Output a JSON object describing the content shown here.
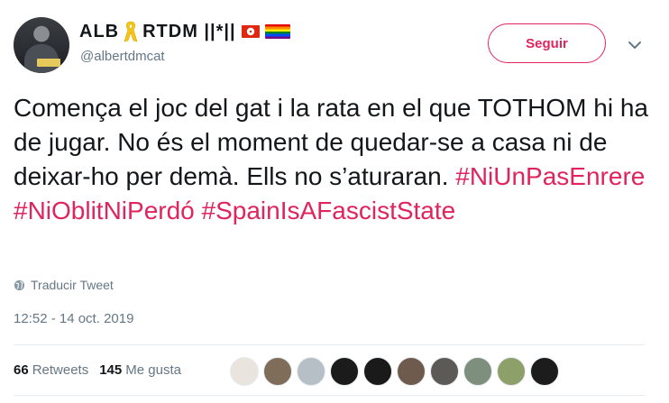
{
  "author": {
    "display_name_left": "ALB",
    "display_name_right": "RTDM ||*||",
    "handle": "@albertdmcat"
  },
  "follow_button": {
    "label": "Seguir"
  },
  "tweet": {
    "text_plain": "Comença el joc del gat i la rata en el que TOTHOM hi ha de jugar. No és el moment de quedar-se a casa ni de deixar-ho per demà. Ells no s’aturaran.",
    "hashtags": [
      "#NiUnPasEnrere",
      "#NiOblitNiPerdó",
      "#SpainIsAFascistState"
    ],
    "translate_label": "Traducir Tweet",
    "timestamp": "12:52 - 14 oct. 2019"
  },
  "stats": {
    "retweets_count": "66",
    "retweets_label": "Retweets",
    "likes_count": "145",
    "likes_label": "Me gusta"
  },
  "colors": {
    "accent": "#e0245e",
    "secondary_text": "#657786",
    "divider": "#e6ecf0"
  },
  "icons": {
    "ribbon": "yellow-ribbon-icon",
    "chevron": "chevron-down-icon",
    "globe": "globe-icon"
  },
  "liker_avatar_colors": [
    "#e9e4de",
    "#7f6d5a",
    "#b7bfc6",
    "#1b1b1b",
    "#1a1a1a",
    "#6f5b4e",
    "#5c5a57",
    "#7f8f7d",
    "#8ea06a",
    "#1c1c1c"
  ]
}
